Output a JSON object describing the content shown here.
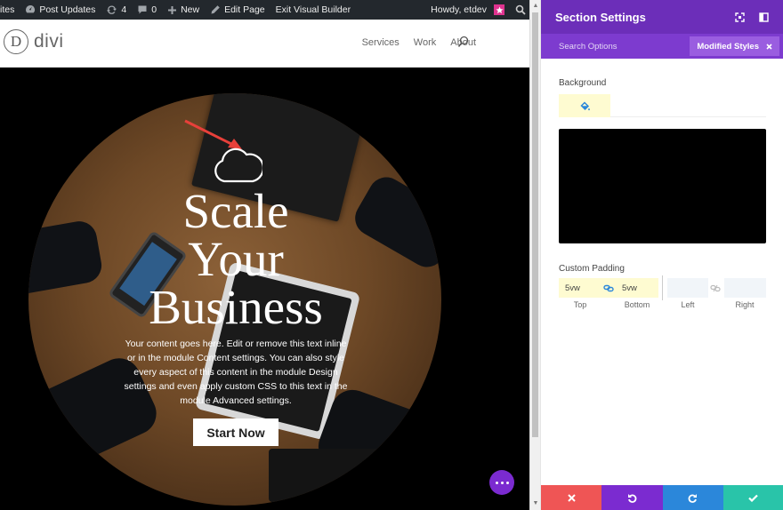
{
  "admin_bar": {
    "sites_label": "ites",
    "post_updates_label": "Post Updates",
    "updates_count": "4",
    "comments_count": "0",
    "new_label": "New",
    "edit_page_label": "Edit Page",
    "exit_vb_label": "Exit Visual Builder",
    "howdy_label": "Howdy, etdev"
  },
  "site": {
    "logo_letter": "D",
    "logo_word": "divi",
    "nav": [
      "Services",
      "Work",
      "About"
    ]
  },
  "hero": {
    "title_lines": [
      "Scale",
      "Your",
      "Business"
    ],
    "body": "Your content goes here. Edit or remove this text inline or in the module Content settings. You can also style every aspect of this content in the module Design settings and even apply custom CSS to this text in the module Advanced settings.",
    "cta_label": "Start Now"
  },
  "panel": {
    "title": "Section Settings",
    "search_options_label": "Search Options",
    "modified_styles_label": "Modified Styles",
    "background_label": "Background",
    "background_color": "#000000",
    "custom_padding_label": "Custom Padding",
    "padding": {
      "top": "5vw",
      "bottom": "5vw",
      "left": "",
      "right": ""
    },
    "padding_captions": [
      "Top",
      "Bottom",
      "Left",
      "Right"
    ]
  },
  "colors": {
    "panel_header": "#6c2eb9",
    "panel_tabs": "#7d3bcf",
    "fab": "#7b2bd0",
    "footer_discard": "#ef5555",
    "footer_undo": "#7b2bd0",
    "footer_redo": "#2b87da",
    "footer_save": "#29c4a9",
    "arrow": "#e8403a"
  }
}
